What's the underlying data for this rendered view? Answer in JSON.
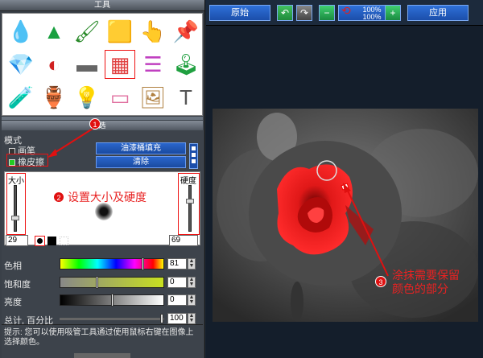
{
  "tools_panel": {
    "title": "工具",
    "tools": [
      {
        "name": "drop-tool-icon",
        "glyph": "💧",
        "color": "#1a7ae0"
      },
      {
        "name": "cone-tool-icon",
        "glyph": "▲",
        "color": "#1aa040"
      },
      {
        "name": "brushes-tool-icon",
        "glyph": "🖌",
        "color": "#2a8a2a"
      },
      {
        "name": "stamp-tool-icon",
        "glyph": "🟨",
        "color": "#e0c020"
      },
      {
        "name": "smudge-tool-icon",
        "glyph": "👆",
        "color": "#d9a080"
      },
      {
        "name": "pushpin-tool-icon",
        "glyph": "📌",
        "color": "#3a6ad0"
      },
      {
        "name": "diamond-tool-icon",
        "glyph": "💎",
        "color": "#aaa"
      },
      {
        "name": "color-circle-tool-icon",
        "glyph": "◐",
        "color": "#d02020"
      },
      {
        "name": "gradient-gray-tool-icon",
        "glyph": "▬",
        "color": "#666"
      },
      {
        "name": "rainbow-gradient-tool-icon",
        "glyph": "▦",
        "color": "#e04040"
      },
      {
        "name": "color-lines-tool-icon",
        "glyph": "☰",
        "color": "#c040c0"
      },
      {
        "name": "joystick-tool-icon",
        "glyph": "🕹",
        "color": "#20a040"
      },
      {
        "name": "tube-tool-icon",
        "glyph": "🧪",
        "color": "#2a8ae0"
      },
      {
        "name": "vase-tool-icon",
        "glyph": "🏺",
        "color": "#c07020"
      },
      {
        "name": "lightbulb-tool-icon",
        "glyph": "💡",
        "color": "#ddd"
      },
      {
        "name": "eraser-tool-icon",
        "glyph": "▭",
        "color": "#e070a0"
      },
      {
        "name": "photo-filter-tool-icon",
        "glyph": "🖼",
        "color": "#b08040"
      },
      {
        "name": "text-tool-icon",
        "glyph": "T",
        "color": "#555"
      }
    ]
  },
  "settings": {
    "title": "选",
    "mode_label": "模式",
    "brush_label": "画笔",
    "eraser_label": "橡皮擦",
    "fill_button": "油漆桶填充",
    "clear_button": "清除",
    "size_label": "大小",
    "hardness_label": "硬度",
    "size_value": "29",
    "hardness_value": "69",
    "size_level": 0.29,
    "hardness_level": 0.69,
    "hue_label": "色相",
    "hue_value": "81",
    "hue_level": 0.81,
    "saturation_label": "饱和度",
    "saturation_value": "0",
    "saturation_level": 0.35,
    "brightness_label": "亮度",
    "brightness_value": "0",
    "brightness_level": 0.5,
    "total_label": "总计, 百分比",
    "total_value": "100",
    "total_level": 1.0,
    "hint_text": "提示: 您可以使用吸管工具通过使用鼠标右键在图像上选择颜色。"
  },
  "toolbar": {
    "original_button": "原始",
    "zoom_readout_top": "100%",
    "zoom_readout_bottom": "100%",
    "apply_button": "应用"
  },
  "annotations": {
    "step1_num": "1",
    "step2_num": "2",
    "step2_text": "设置大小及硬度",
    "step3_num": "3",
    "step3_text_line1": "涂抹需要保留",
    "step3_text_line2": "颜色的部分"
  },
  "colors": {
    "accent_blue": "#1b4eaa",
    "annotation_red": "#e01010",
    "panel_bg": "#3d434b"
  }
}
